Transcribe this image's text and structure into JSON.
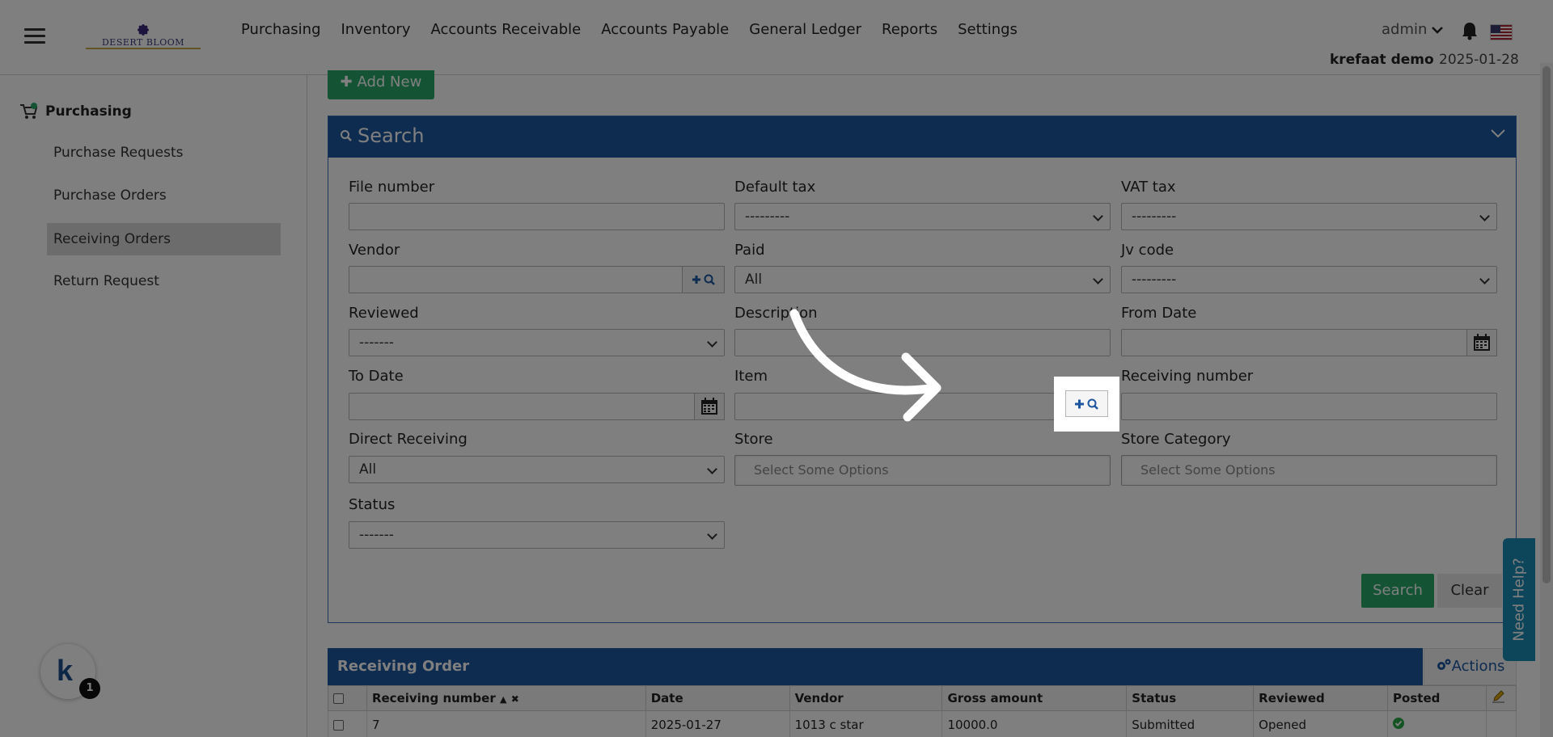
{
  "topbar": {
    "logo_text": "DESERT BLOOM",
    "nav": [
      "Purchasing",
      "Inventory",
      "Accounts Receivable",
      "Accounts Payable",
      "General Ledger",
      "Reports",
      "Settings"
    ],
    "user": "admin",
    "company": "krefaat demo",
    "date": "2025-01-28"
  },
  "sidebar": {
    "title": "Purchasing",
    "items": [
      "Purchase Requests",
      "Purchase Orders",
      "Receiving Orders",
      "Return Request"
    ],
    "active_index": 2,
    "badge_count": "1"
  },
  "main": {
    "add_new": "Add New",
    "search_title": "Search",
    "fields": {
      "file_number": {
        "label": "File number",
        "value": ""
      },
      "default_tax": {
        "label": "Default tax",
        "value": "---------"
      },
      "vat_tax": {
        "label": "VAT tax",
        "value": "---------"
      },
      "vendor": {
        "label": "Vendor",
        "value": ""
      },
      "paid": {
        "label": "Paid",
        "value": "All"
      },
      "jv_code": {
        "label": "Jv code",
        "value": "---------"
      },
      "reviewed": {
        "label": "Reviewed",
        "value": "-------"
      },
      "description": {
        "label": "Description",
        "value": ""
      },
      "from_date": {
        "label": "From Date",
        "value": ""
      },
      "to_date": {
        "label": "To Date",
        "value": ""
      },
      "item": {
        "label": "Item",
        "value": ""
      },
      "receiving_number": {
        "label": "Receiving number",
        "value": ""
      },
      "direct_receiving": {
        "label": "Direct Receiving",
        "value": "All"
      },
      "store": {
        "label": "Store",
        "placeholder": "Select Some Options"
      },
      "store_category": {
        "label": "Store Category",
        "placeholder": "Select Some Options"
      },
      "status": {
        "label": "Status",
        "value": "-------"
      }
    },
    "search_btn": "Search",
    "clear_btn": "Clear",
    "help": "Need Help?"
  },
  "results": {
    "title": "Receiving Order",
    "actions": "Actions",
    "columns": [
      "Receiving number",
      "Date",
      "Vendor",
      "Gross amount",
      "Status",
      "Reviewed",
      "Posted"
    ],
    "rows": [
      {
        "receiving_number": "7",
        "date": "2025-01-27",
        "vendor": "1013 c star",
        "gross_amount": "10000.0",
        "status": "Submitted",
        "reviewed": "Opened",
        "posted": true
      }
    ]
  },
  "colors": {
    "header_blue": "#1d56a0",
    "success_green": "#28a86a",
    "help_blue": "#1a8ab5"
  }
}
